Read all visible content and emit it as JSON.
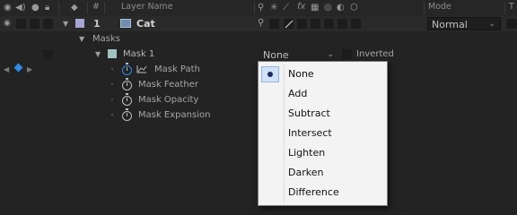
{
  "header": {
    "number_symbol": "#",
    "layer_name_label": "Layer Name",
    "fx_symbol": "fx",
    "mode_label": "Mode",
    "trkmat_label": "T"
  },
  "layer": {
    "number": "1",
    "name": "Cat",
    "mode_value": "Normal",
    "label_color": "#a6a6d6"
  },
  "masks_group": {
    "label": "Masks"
  },
  "mask": {
    "name": "Mask 1",
    "mode_value": "None",
    "inverted_label": "Inverted",
    "color": "#9ec3c1",
    "properties": [
      {
        "label": "Mask Path"
      },
      {
        "label": "Mask Feather"
      },
      {
        "label": "Mask Opacity"
      },
      {
        "label": "Mask Expansion"
      }
    ]
  },
  "mode_menu": {
    "items": [
      "None",
      "Add",
      "Subtract",
      "Intersect",
      "Lighten",
      "Darken",
      "Difference"
    ],
    "selected": "None"
  },
  "colors": {
    "keyframe_nav": "#2d8ceb",
    "panel_bg": "#232323",
    "menu_bg": "#f3f3f3"
  }
}
